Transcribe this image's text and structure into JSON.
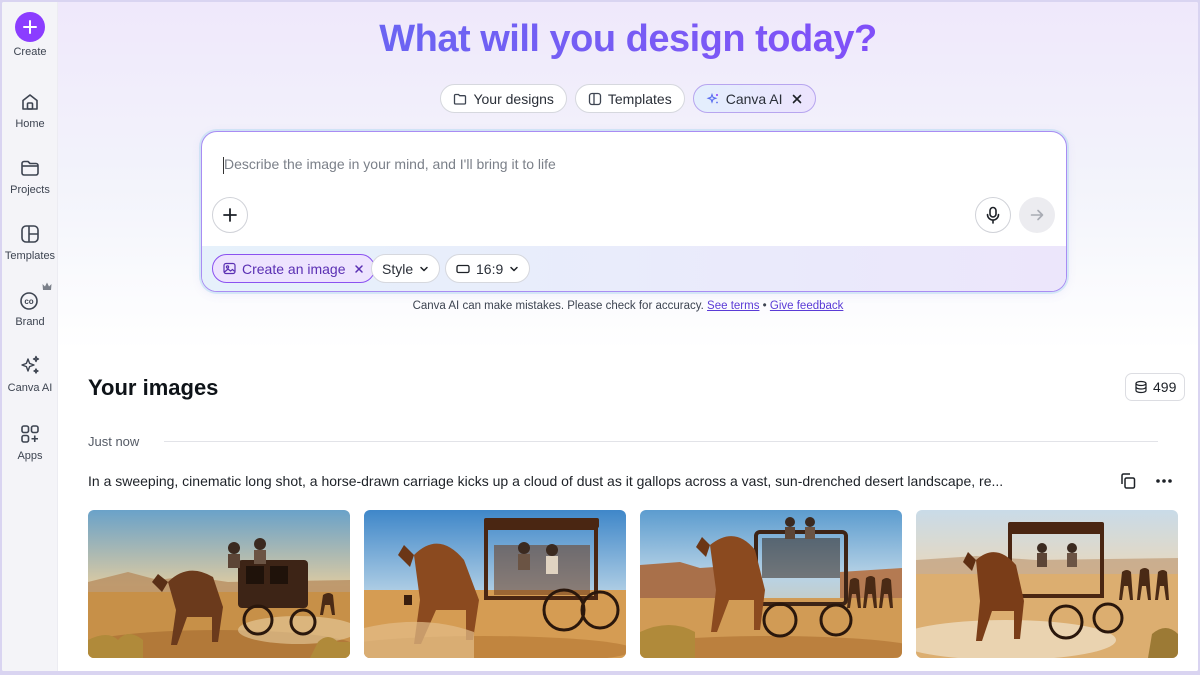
{
  "sidebar": {
    "items": [
      {
        "label": "Create"
      },
      {
        "label": "Home"
      },
      {
        "label": "Projects"
      },
      {
        "label": "Templates"
      },
      {
        "label": "Brand"
      },
      {
        "label": "Canva AI"
      },
      {
        "label": "Apps"
      }
    ]
  },
  "hero": {
    "title": "What will you design today?"
  },
  "tabs": [
    {
      "label": "Your designs"
    },
    {
      "label": "Templates"
    },
    {
      "label": "Canva AI"
    }
  ],
  "prompt": {
    "placeholder": "Describe the image in your mind, and I'll bring it to life",
    "value": "",
    "chips": {
      "mode": "Create an image",
      "style": "Style",
      "ratio": "16:9"
    }
  },
  "disclaimer": {
    "text": "Canva AI can make mistakes. Please check for accuracy.",
    "terms_link": "See terms",
    "separator": "•",
    "feedback_link": "Give feedback"
  },
  "images_section": {
    "title": "Your images",
    "credits": "499",
    "time_label": "Just now",
    "prompt_text": "In a sweeping, cinematic long shot, a horse-drawn carriage kicks up a cloud of dust as it gallops across a vast, sun-drenched desert landscape, re...",
    "thumbnails": [
      {
        "name": "image-result-1"
      },
      {
        "name": "image-result-2"
      },
      {
        "name": "image-result-3"
      },
      {
        "name": "image-result-4"
      }
    ]
  },
  "colors": {
    "brand": "#8b3dff",
    "accent_blue": "#5b6ff0"
  }
}
